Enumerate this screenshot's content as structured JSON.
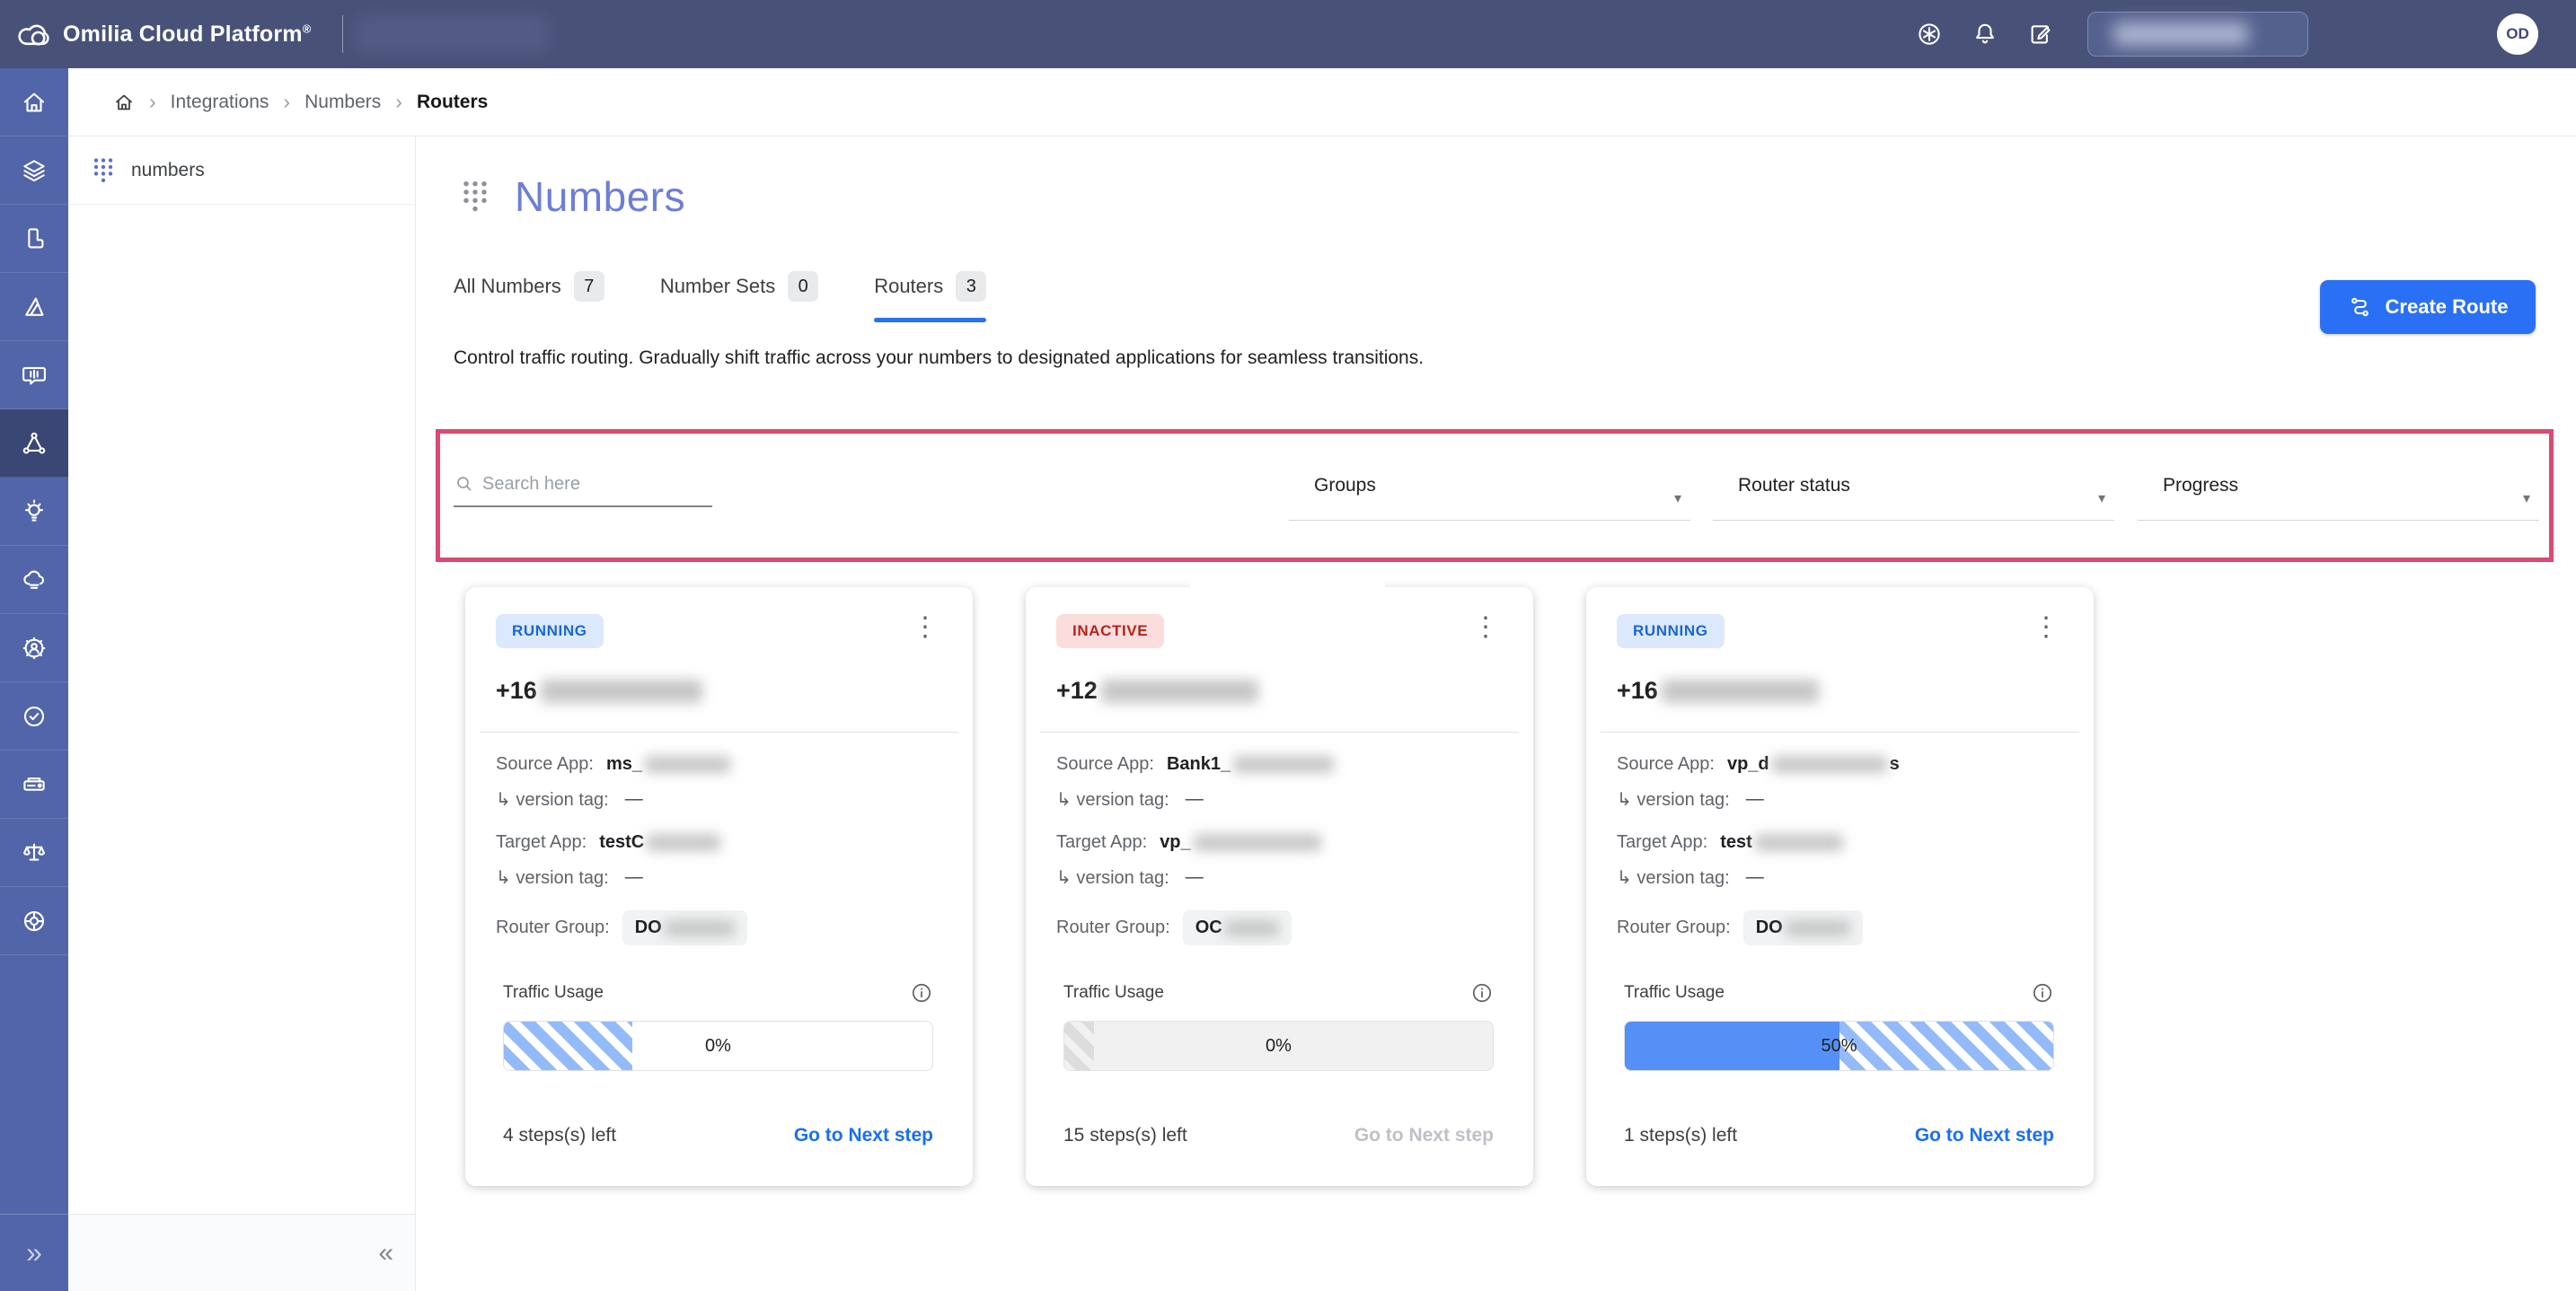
{
  "colors": {
    "navbar_bg": "#485178",
    "sidebar_bg": "#5265a9",
    "sidebar_active_bg": "#3a4673",
    "accent_blue": "#2a70f5",
    "tab_underline": "#2b6ff3",
    "title_blue": "#6d7ed6",
    "filter_highlight_border": "#da4a72",
    "status_running_text": "#1967d2",
    "status_running_bg": "#dce9fc",
    "status_inactive_text": "#b3251c",
    "status_inactive_bg": "#fbdddd",
    "progress_fill": "#5590f6",
    "progress_stripe": "#93baf9",
    "link_blue": "#1a6ef5",
    "link_disabled": "#bdc1c6"
  },
  "navbar": {
    "brand": "Omilia Cloud Platform",
    "brand_sup": "®",
    "icons": [
      "apps-asterisk",
      "notifications-bell",
      "compose-note"
    ],
    "avatar": "OD",
    "redacted_nav_item_w": 215,
    "redacted_pill_inner_w": 150
  },
  "sidebar": {
    "items": [
      {
        "icon": "home",
        "active": false
      },
      {
        "icon": "layers",
        "active": false
      },
      {
        "icon": "telephony",
        "active": false
      },
      {
        "icon": "design-compass",
        "active": false
      },
      {
        "icon": "voice-chat",
        "active": false
      },
      {
        "icon": "integrations-network",
        "active": true
      },
      {
        "icon": "insights-bulb",
        "active": false
      },
      {
        "icon": "cloud",
        "active": false
      },
      {
        "icon": "user-settings",
        "active": false
      },
      {
        "icon": "quality-badge",
        "active": false
      },
      {
        "icon": "hardware",
        "active": false
      },
      {
        "icon": "compliance-scale",
        "active": false
      },
      {
        "icon": "support-lifebuoy",
        "active": false
      }
    ],
    "expand_glyph": "»"
  },
  "breadcrumb": {
    "items": [
      "Integrations",
      "Numbers"
    ],
    "current": "Routers",
    "separator": "›"
  },
  "panel": {
    "item_label": "numbers",
    "collapse_glyph": "«"
  },
  "page": {
    "title": "Numbers",
    "description": "Control traffic routing. Gradually shift traffic across your numbers to designated applications for seamless transitions."
  },
  "tabs": [
    {
      "label": "All Numbers",
      "count": "7",
      "active": false
    },
    {
      "label": "Number Sets",
      "count": "0",
      "active": false
    },
    {
      "label": "Routers",
      "count": "3",
      "active": true
    }
  ],
  "create_button": {
    "label": "Create Route"
  },
  "filters": {
    "search_placeholder": "Search here",
    "dropdowns": [
      "Groups",
      "Router status",
      "Progress"
    ]
  },
  "card_labels": {
    "source": "Source App:",
    "version": "↳ version tag:",
    "target": "Target App:",
    "group": "Router Group:",
    "traffic": "Traffic Usage"
  },
  "cards": [
    {
      "status": "RUNNING",
      "status_type": "running",
      "phone_prefix": "+16",
      "phone_mask_w": 180,
      "source_prefix": "ms_",
      "source_suffix": "",
      "source_mask_w": 95,
      "version_value": "—",
      "target_prefix": "testC",
      "target_mask_w": 82,
      "target_version_value": "—",
      "group_prefix": "DO",
      "group_mask_w": 78,
      "progress": {
        "percent_text": "0%",
        "fill_pct": 0,
        "stripe_start": 0,
        "stripe_end": 30,
        "stripe_style": "blue",
        "bar_style": "white"
      },
      "steps_left": "4 steps(s) left",
      "next_label": "Go to Next step",
      "next_enabled": true
    },
    {
      "status": "INACTIVE",
      "status_type": "inactive",
      "phone_prefix": "+12",
      "phone_mask_w": 175,
      "source_prefix": "Bank1_",
      "source_suffix": "",
      "source_mask_w": 112,
      "version_value": "—",
      "target_prefix": "vp_",
      "target_mask_w": 142,
      "target_version_value": "—",
      "group_prefix": "OC",
      "group_mask_w": 60,
      "progress": {
        "percent_text": "0%",
        "fill_pct": 0,
        "stripe_start": 0,
        "stripe_end": 7,
        "stripe_style": "grey",
        "bar_style": "gray"
      },
      "steps_left": "15 steps(s) left",
      "next_label": "Go to Next step",
      "next_enabled": false
    },
    {
      "status": "RUNNING",
      "status_type": "running",
      "phone_prefix": "+16",
      "phone_mask_w": 175,
      "source_prefix": "vp_d",
      "source_suffix": "s",
      "source_mask_w": 128,
      "version_value": "—",
      "target_prefix": "test",
      "target_mask_w": 98,
      "target_version_value": "—",
      "group_prefix": "DO",
      "group_mask_w": 72,
      "progress": {
        "percent_text": "50%",
        "fill_pct": 50,
        "stripe_start": 50,
        "stripe_end": 100,
        "stripe_style": "blue",
        "bar_style": "white"
      },
      "steps_left": "1 steps(s) left",
      "next_label": "Go to Next step",
      "next_enabled": true
    }
  ]
}
